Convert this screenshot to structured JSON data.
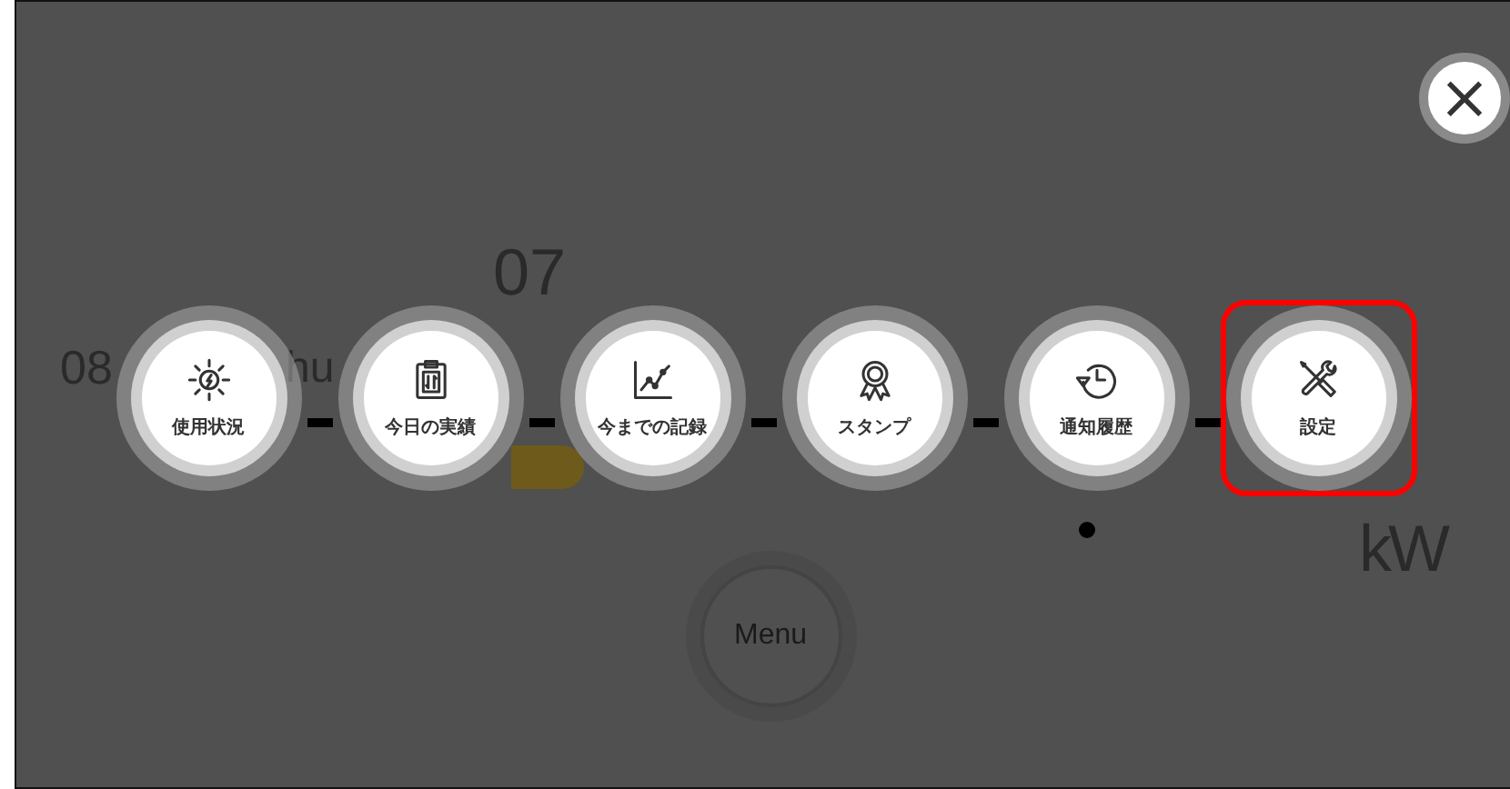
{
  "background": {
    "date": "08",
    "weekday": "hu",
    "time": "07",
    "unit": "kW"
  },
  "close_button": {
    "label": "×"
  },
  "menu_items": [
    {
      "label": "使用状況",
      "selected": false
    },
    {
      "label": "今日の実績",
      "selected": false
    },
    {
      "label": "今までの記録",
      "selected": false
    },
    {
      "label": "スタンプ",
      "selected": false
    },
    {
      "label": "通知履歴",
      "selected": false
    },
    {
      "label": "設定",
      "selected": true
    }
  ],
  "menu_button": {
    "label": "Menu"
  }
}
